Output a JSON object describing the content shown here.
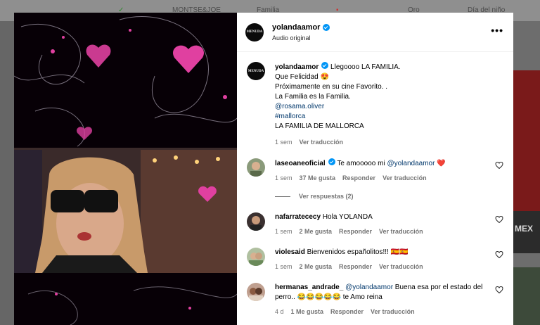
{
  "background": {
    "items": [
      "MONTSE&JOE",
      "Familia",
      "Oro",
      "Día del niño"
    ],
    "right_text": "MEX"
  },
  "post": {
    "username": "yolandaamor",
    "audio": "Audio original",
    "avatar_text": "MENUDA",
    "caption": {
      "username": "yolandaamor",
      "line1": "Llegoooo LA FAMILIA.",
      "line2": "Que Felicidad 😍",
      "line3": "Próximamente en su cine Favorito. .",
      "line4": "La Familia es la Familia.",
      "mention": "@rosama.oliver",
      "hashtag": "#mallorca",
      "line7": "LA FAMILIA DE MALLORCA",
      "time": "1 sem",
      "translate": "Ver traducción"
    }
  },
  "comments": [
    {
      "username": "laseoaneoficial",
      "text": "Te amooooo mi ",
      "mention": "@yolandaamor",
      "emoji": "❤️",
      "time": "1 sem",
      "likes": "37 Me gusta",
      "reply": "Responder",
      "translate": "Ver traducción",
      "replies": "Ver respuestas (2)"
    },
    {
      "username": "nafarratececy",
      "text": "Hola YOLANDA",
      "time": "1 sem",
      "likes": "2 Me gusta",
      "reply": "Responder",
      "translate": "Ver traducción"
    },
    {
      "username": "violesaid",
      "text": "Bienvenidos españolitos!!! 🇪🇸🇪🇸",
      "time": "1 sem",
      "likes": "2 Me gusta",
      "reply": "Responder",
      "translate": "Ver traducción"
    },
    {
      "username": "hermanas_andrade_",
      "mention": "@yolandaamor",
      "text": " Buena esa por el estado del perro.. 😂😂😂😂😂 te Amo reina",
      "time": "4 d",
      "likes": "1 Me gusta",
      "reply": "Responder",
      "translate": "Ver traducción"
    }
  ],
  "colors": {
    "accent": "#0095f6",
    "link": "#00376b",
    "muted": "#737373",
    "heart": "#ed4956"
  }
}
